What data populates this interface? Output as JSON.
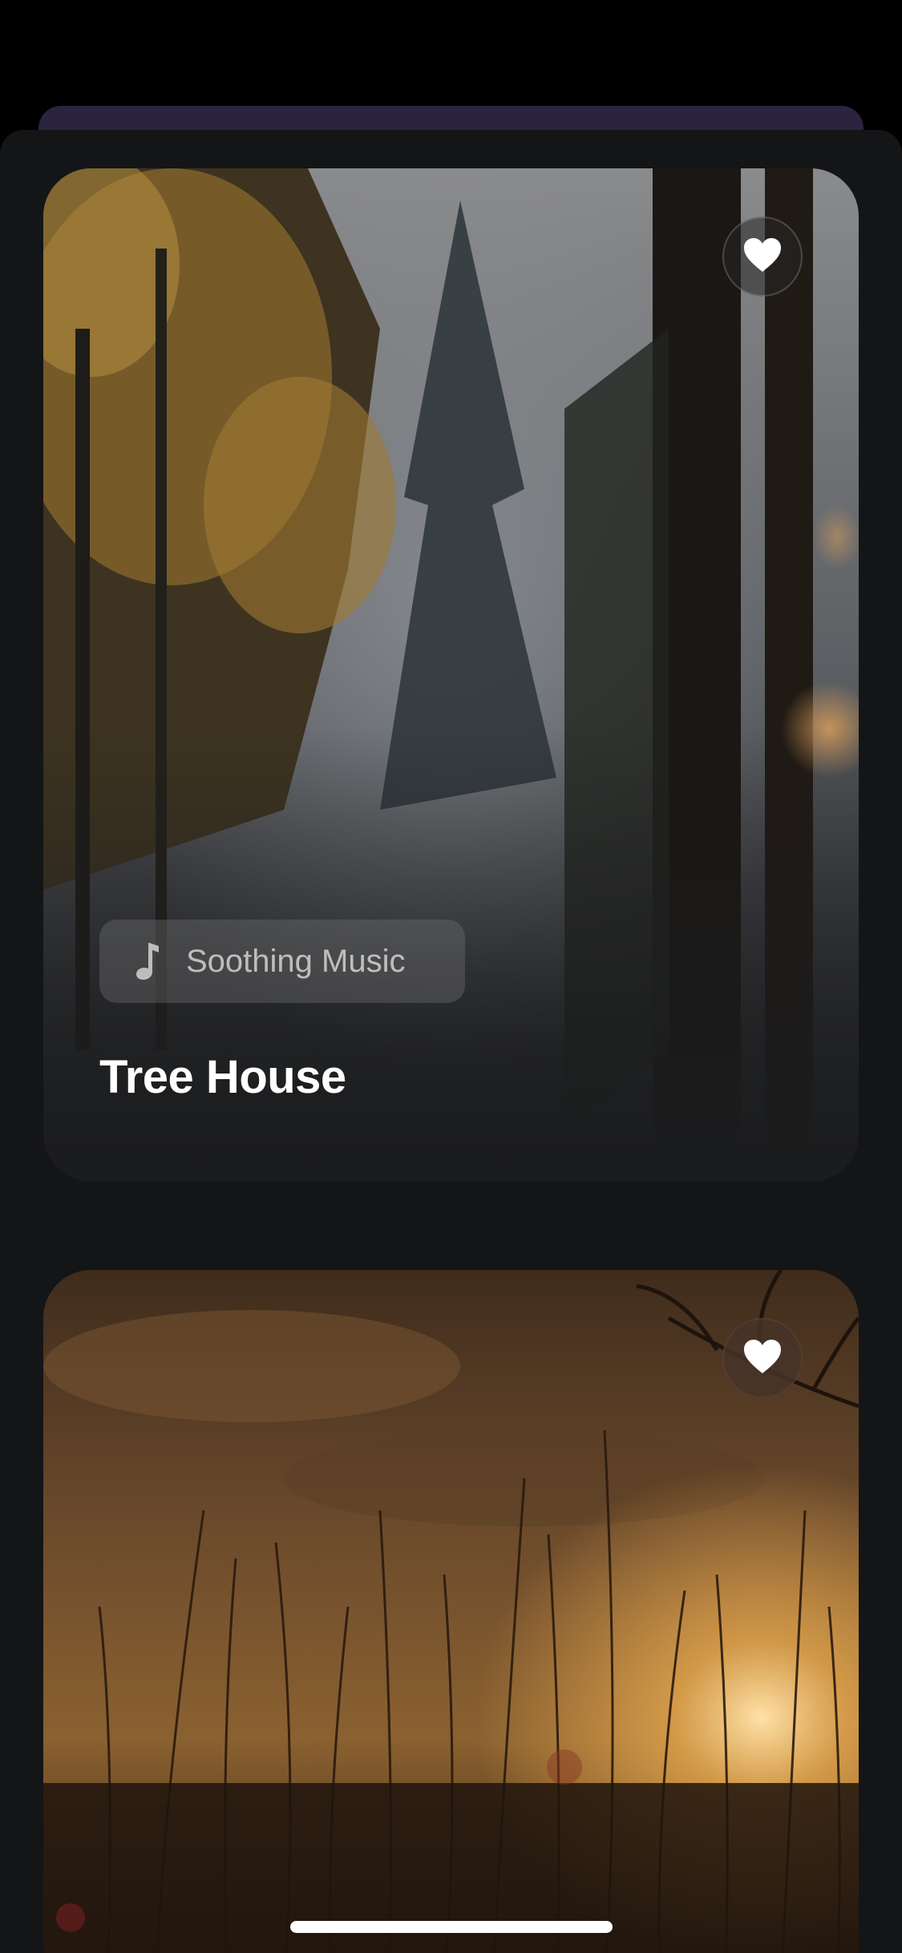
{
  "cards": [
    {
      "tag_icon": "music-note-icon",
      "tag_label": "Soothing Music",
      "title": "Tree House",
      "favorite_icon": "heart-icon"
    },
    {
      "favorite_icon": "heart-icon"
    }
  ],
  "colors": {
    "background": "#000000",
    "sheet": "#141517",
    "behind_sheet": "#2a2440",
    "title_text": "#ffffff",
    "home_indicator": "#ffffff"
  }
}
